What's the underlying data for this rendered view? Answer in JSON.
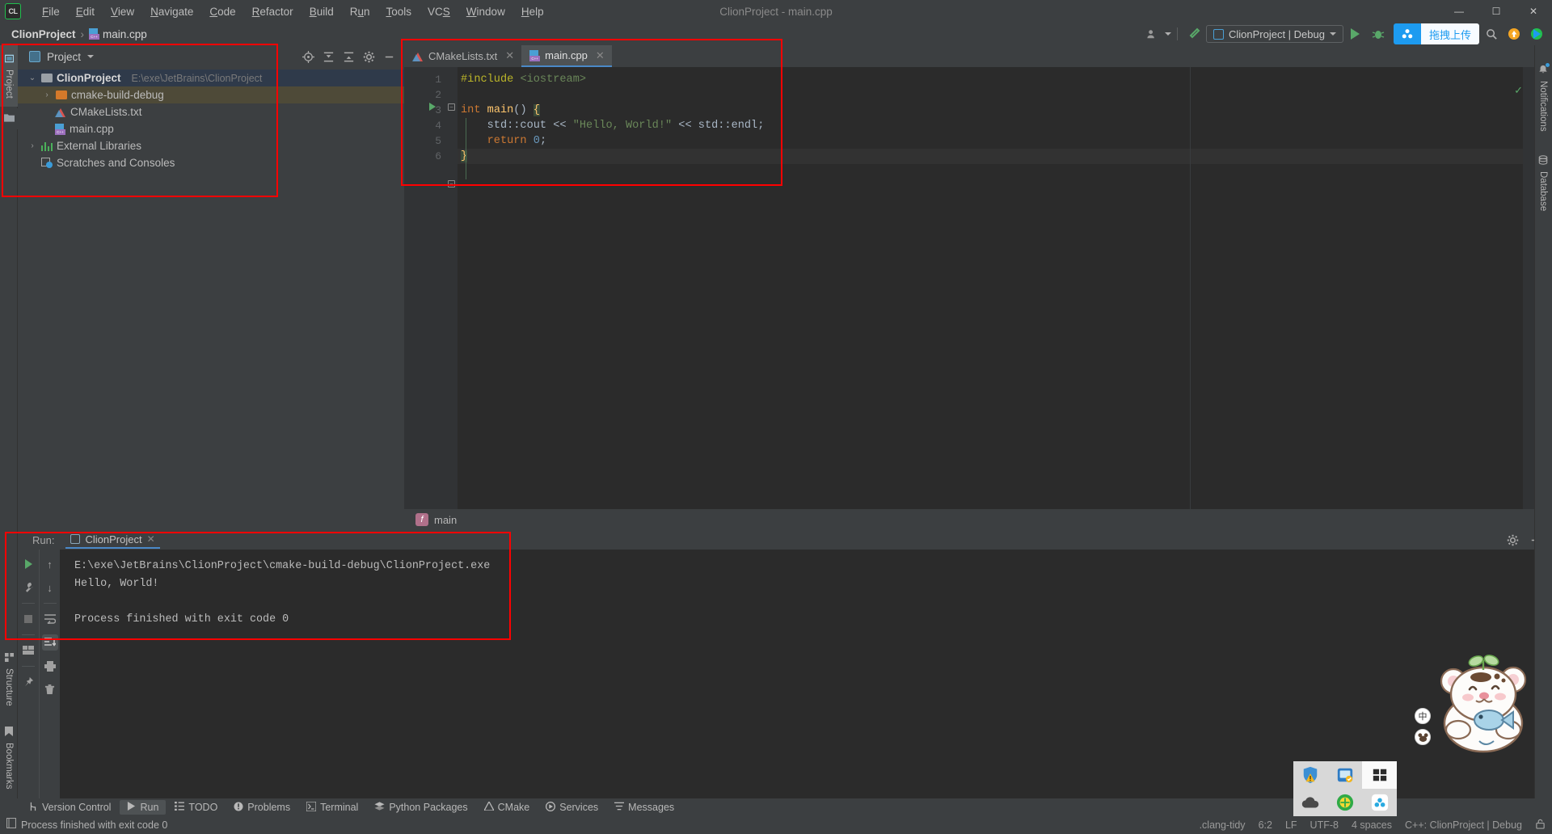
{
  "titlebar": {
    "logo": "CL",
    "window_title": "ClionProject - main.cpp",
    "menu": [
      "File",
      "Edit",
      "View",
      "Navigate",
      "Code",
      "Refactor",
      "Build",
      "Run",
      "Tools",
      "VCS",
      "Window",
      "Help"
    ],
    "minimize": "—",
    "maximize": "☐",
    "close": "✕"
  },
  "navbar": {
    "breadcrumb_project": "ClionProject",
    "breadcrumb_sep": "›",
    "breadcrumb_file": "main.cpp",
    "run_config": "ClionProject | Debug",
    "upload_badge": "拖拽上传",
    "icons": {
      "users": "👤",
      "hammer": "build-hammer",
      "run": "run",
      "debug": "debug",
      "search": "🔍",
      "update": "⬆",
      "plugin": "▶"
    }
  },
  "left_strip": {
    "tabs": [
      {
        "label": "Project",
        "icon": "project-icon",
        "active": true
      },
      {
        "label": "Structure",
        "icon": "structure-icon",
        "active": false
      },
      {
        "label": "Bookmarks",
        "icon": "bookmark-icon",
        "active": false
      }
    ]
  },
  "right_strip": {
    "tabs": [
      {
        "label": "Notifications",
        "icon": "bell-icon"
      },
      {
        "label": "Database",
        "icon": "database-icon"
      }
    ]
  },
  "project_panel": {
    "title": "Project",
    "tools": [
      "locate-icon",
      "expand-all-icon",
      "collapse-all-icon",
      "gear-icon",
      "minimize-icon"
    ],
    "tree": [
      {
        "label": "ClionProject",
        "path": "E:\\exe\\JetBrains\\ClionProject",
        "icon": "folder-grey",
        "arrow": "⌄",
        "depth": 0,
        "state": "sel"
      },
      {
        "label": "cmake-build-debug",
        "path": "",
        "icon": "folder-orange",
        "arrow": "›",
        "depth": 1,
        "state": "sel2"
      },
      {
        "label": "CMakeLists.txt",
        "path": "",
        "icon": "cmake-icon",
        "arrow": "",
        "depth": 1,
        "state": ""
      },
      {
        "label": "main.cpp",
        "path": "",
        "icon": "cpp-icon",
        "arrow": "",
        "depth": 1,
        "state": ""
      },
      {
        "label": "External Libraries",
        "path": "",
        "icon": "library-icon",
        "arrow": "›",
        "depth": 0,
        "state": ""
      },
      {
        "label": "Scratches and Consoles",
        "path": "",
        "icon": "scratch-icon",
        "arrow": "",
        "depth": 0,
        "state": ""
      }
    ]
  },
  "editor": {
    "tabs": [
      {
        "label": "CMakeLists.txt",
        "icon": "cmake-icon",
        "active": false
      },
      {
        "label": "main.cpp",
        "icon": "cpp-icon",
        "active": true
      }
    ],
    "line_numbers": [
      "1",
      "2",
      "3",
      "4",
      "5",
      "6"
    ],
    "code_lines": [
      "#include <iostream>",
      "",
      "int main() {",
      "    std::cout << \"Hello, World!\" << std::endl;",
      "    return 0;",
      "}"
    ],
    "breadcrumb": "main",
    "breadcrumb_icon": "function-icon",
    "inspection_status": "✓"
  },
  "run_window": {
    "label": "Run:",
    "tab": "ClionProject",
    "toolbar_primary": [
      "rerun-icon",
      "settings-wrench-icon",
      "stop-icon",
      "layout-icon",
      "pin-icon"
    ],
    "toolbar_secondary": [
      "up-arrow-icon",
      "down-arrow-icon",
      "soft-wrap-icon",
      "scroll-to-end-icon",
      "print-icon",
      "trash-icon"
    ],
    "header_tools": [
      "gear-icon",
      "minimize-icon"
    ],
    "console_lines": [
      "E:\\exe\\JetBrains\\ClionProject\\cmake-build-debug\\ClionProject.exe",
      "Hello, World!",
      "",
      "Process finished with exit code 0"
    ]
  },
  "bottom_bar": {
    "items": [
      {
        "label": "Version Control",
        "icon": "branch-icon",
        "active": false
      },
      {
        "label": "Run",
        "icon": "run-icon",
        "active": true
      },
      {
        "label": "TODO",
        "icon": "todo-icon",
        "active": false
      },
      {
        "label": "Problems",
        "icon": "problems-icon",
        "active": false
      },
      {
        "label": "Terminal",
        "icon": "terminal-icon",
        "active": false
      },
      {
        "label": "Python Packages",
        "icon": "python-packages-icon",
        "active": false
      },
      {
        "label": "CMake",
        "icon": "cmake-icon",
        "active": false
      },
      {
        "label": "Services",
        "icon": "services-icon",
        "active": false
      },
      {
        "label": "Messages",
        "icon": "messages-icon",
        "active": false
      }
    ]
  },
  "statusbar": {
    "message": "Process finished with exit code 0",
    "message_icon": "console-icon",
    "right": [
      ".clang-tidy",
      "6:2",
      "LF",
      "UTF-8",
      "4 spaces",
      "C++: ClionProject | Debug"
    ],
    "lock_icon": "🔓"
  },
  "overlay": {
    "tray_icons": [
      "shield-warning-icon",
      "network-icon",
      "windows-icon",
      "cloud-icon",
      "green-plus-icon",
      "baidu-cloud-icon"
    ],
    "ime_badges": [
      "中",
      "mouse-icon"
    ],
    "mascot": "bear-with-fish-mascot"
  },
  "colors": {
    "accent_blue": "#4a88c7",
    "run_green": "#59a869",
    "annotation_red": "#ff0000",
    "editor_bg": "#2b2b2b",
    "panel_bg": "#3c3f41",
    "upload_blue": "#1d9bf0"
  }
}
